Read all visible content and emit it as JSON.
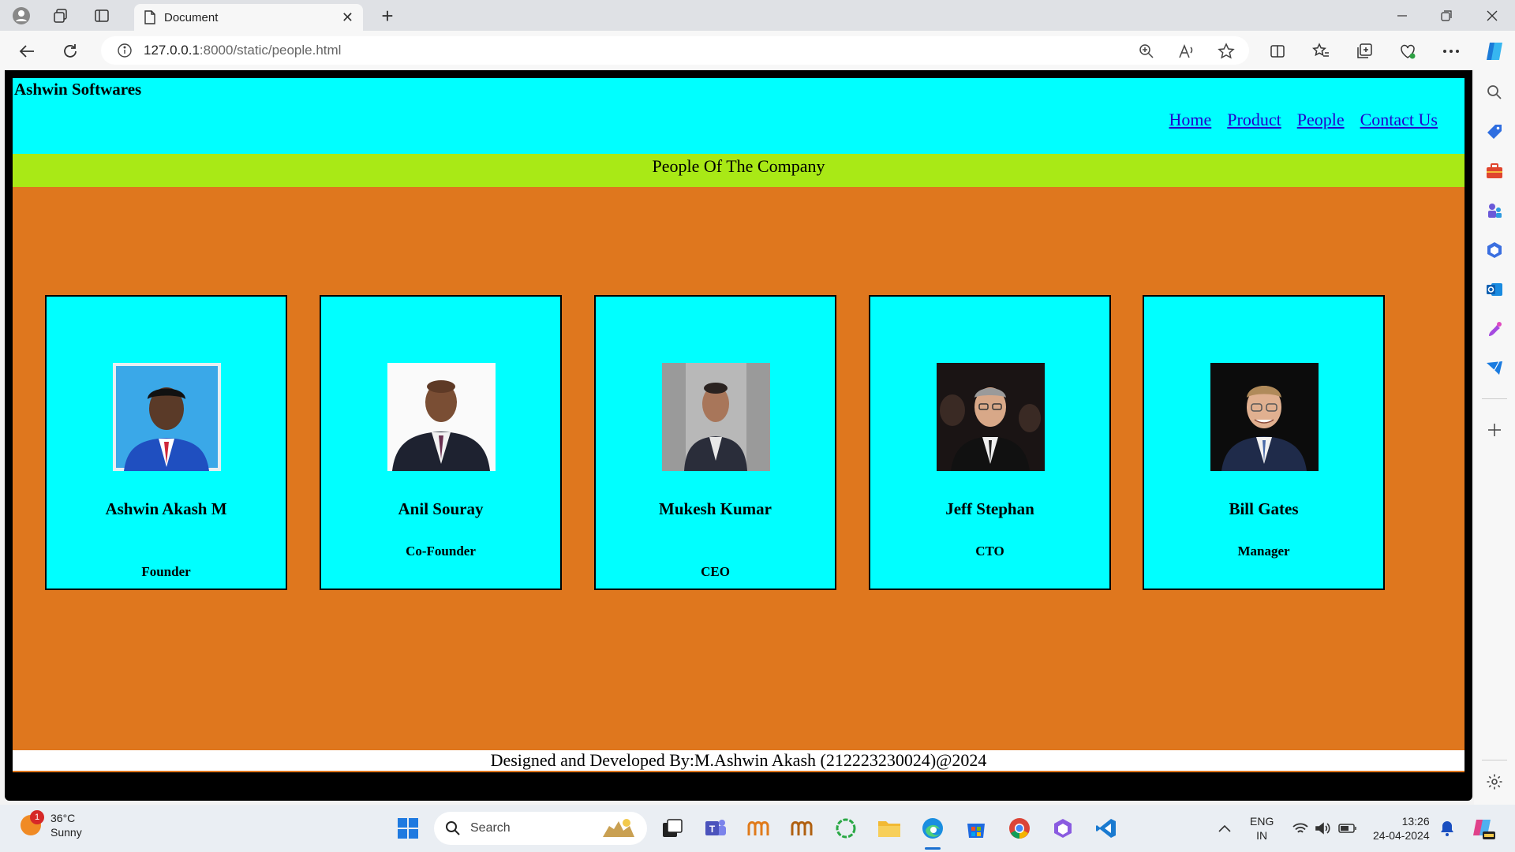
{
  "browser": {
    "tab_title": "Document",
    "close_glyph": "✕",
    "new_tab_glyph": "+",
    "url_host": "127.0.0.1",
    "url_path": ":8000/static/people.html"
  },
  "site": {
    "company": "Ashwin Softwares",
    "nav": [
      "Home",
      "Product",
      "People",
      "Contact Us"
    ],
    "banner": "People Of The Company",
    "people": [
      {
        "name": "Ashwin Akash M",
        "role": "Founder"
      },
      {
        "name": "Anil Souray",
        "role": "Co-Founder"
      },
      {
        "name": "Mukesh Kumar",
        "role": "CEO"
      },
      {
        "name": "Jeff Stephan",
        "role": "CTO"
      },
      {
        "name": "Bill Gates",
        "role": "Manager"
      }
    ],
    "footer": "Designed and Developed By:M.Ashwin Akash (212223230024)@2024"
  },
  "taskbar": {
    "weather_badge": "1",
    "temperature": "36°C",
    "condition": "Sunny",
    "search_label": "Search",
    "lang_1": "ENG",
    "lang_2": "IN",
    "time": "13:26",
    "date": "24-04-2024"
  },
  "colors": {
    "page_bg": "#df771e",
    "header_bg": "#00ffff",
    "banner_bg": "#a9e916",
    "card_bg": "#00ffff"
  }
}
